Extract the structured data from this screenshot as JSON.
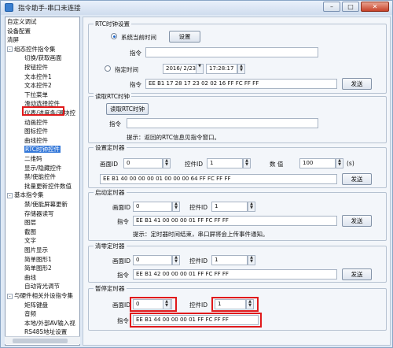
{
  "window": {
    "title": "指令助手-串口未连接",
    "minimize": "–",
    "maximize": "□",
    "close": "✕"
  },
  "tree": {
    "items": [
      {
        "label": "自定义调试",
        "indent": 0
      },
      {
        "label": "设备配置",
        "indent": 0
      },
      {
        "label": "清屏",
        "indent": 0
      },
      {
        "label": "组态控件指令集",
        "indent": 0,
        "expander": "-"
      },
      {
        "label": "切换/获取画面",
        "indent": 1
      },
      {
        "label": "按钮控件",
        "indent": 1
      },
      {
        "label": "文本控件1",
        "indent": 1
      },
      {
        "label": "文本控件2",
        "indent": 1
      },
      {
        "label": "下拉菜单",
        "indent": 1
      },
      {
        "label": "滑动选择控件",
        "indent": 1
      },
      {
        "label": "仪表/进度条/滑块控",
        "indent": 1
      },
      {
        "label": "动画控件",
        "indent": 1
      },
      {
        "label": "图标控件",
        "indent": 1
      },
      {
        "label": "曲线控件",
        "indent": 1
      },
      {
        "label": "RTC时钟控件",
        "indent": 1,
        "selected": true
      },
      {
        "label": "二维码",
        "indent": 1
      },
      {
        "label": "显示/隐藏控件",
        "indent": 1
      },
      {
        "label": "禁/使能控件",
        "indent": 1
      },
      {
        "label": "批量更新控件数值",
        "indent": 1
      },
      {
        "label": "基本指令集",
        "indent": 0,
        "expander": "-"
      },
      {
        "label": "禁/使能屏幕更新",
        "indent": 1
      },
      {
        "label": "存储器读写",
        "indent": 1
      },
      {
        "label": "图层",
        "indent": 1
      },
      {
        "label": "截图",
        "indent": 1
      },
      {
        "label": "文字",
        "indent": 1
      },
      {
        "label": "图片显示",
        "indent": 1
      },
      {
        "label": "简单图形1",
        "indent": 1
      },
      {
        "label": "简单图形2",
        "indent": 1
      },
      {
        "label": "曲线",
        "indent": 1
      },
      {
        "label": "自动背光调节",
        "indent": 1
      },
      {
        "label": "与硬件相关外设指令集",
        "indent": 0,
        "expander": "-"
      },
      {
        "label": "矩阵键盘",
        "indent": 1
      },
      {
        "label": "音频",
        "indent": 1
      },
      {
        "label": "本地/外部AV输入视",
        "indent": 1
      },
      {
        "label": "RS485地址设置",
        "indent": 1
      }
    ]
  },
  "rtc_settings": {
    "title": "RTC时钟设置",
    "system_time_label": "系统当前时间",
    "set_button": "设置",
    "cmd_label": "指令",
    "cmd_value_1": "",
    "specified_time_label": "指定时间",
    "date_value": "2016/ 2/23",
    "time_value": "17:28:17",
    "cmd_value_2": "EE B1 17 28 17 23 02 02 16 FF FC FF FF",
    "send_button": "发送"
  },
  "read_rtc": {
    "title": "读取RTC时钟",
    "read_button": "读取RTC时钟",
    "cmd_label": "指令",
    "cmd_value": "",
    "hint": "提示：返回的RTC信息见指令窗口。"
  },
  "set_timer": {
    "title": "设置定时器",
    "screen_id_label": "画面ID",
    "screen_id": "0",
    "control_id_label": "控件ID",
    "control_id": "1",
    "value_label": "数  值",
    "value": "100",
    "unit": "(s)",
    "cmd_value": "EE B1 40 00 00 00 01 00 00 00 64 FF FC FF FF",
    "send_button": "发送"
  },
  "start_timer": {
    "title": "启动定时器",
    "screen_id_label": "画面ID",
    "screen_id": "0",
    "control_id_label": "控件ID",
    "control_id": "1",
    "cmd_label": "指令",
    "cmd_value": "EE B1 41 00 00 00 01 FF FC FF FF",
    "send_button": "发送",
    "hint": "提示：定时器时间结束，串口屏将会上传事件通知。"
  },
  "clear_timer": {
    "title": "清零定时器",
    "screen_id_label": "画面ID",
    "screen_id": "0",
    "control_id_label": "控件ID",
    "control_id": "1",
    "cmd_label": "指令",
    "cmd_value": "EE B1 42 00 00 00 01 FF FC FF FF",
    "send_button": "发送"
  },
  "pause_timer": {
    "title": "暂停定时器",
    "screen_id_label": "画面ID",
    "screen_id": "0",
    "control_id_label": "控件ID",
    "control_id": "1",
    "cmd_label": "指令",
    "cmd_value": "EE B1 44 00 00 00 01 FF FC FF FF"
  }
}
